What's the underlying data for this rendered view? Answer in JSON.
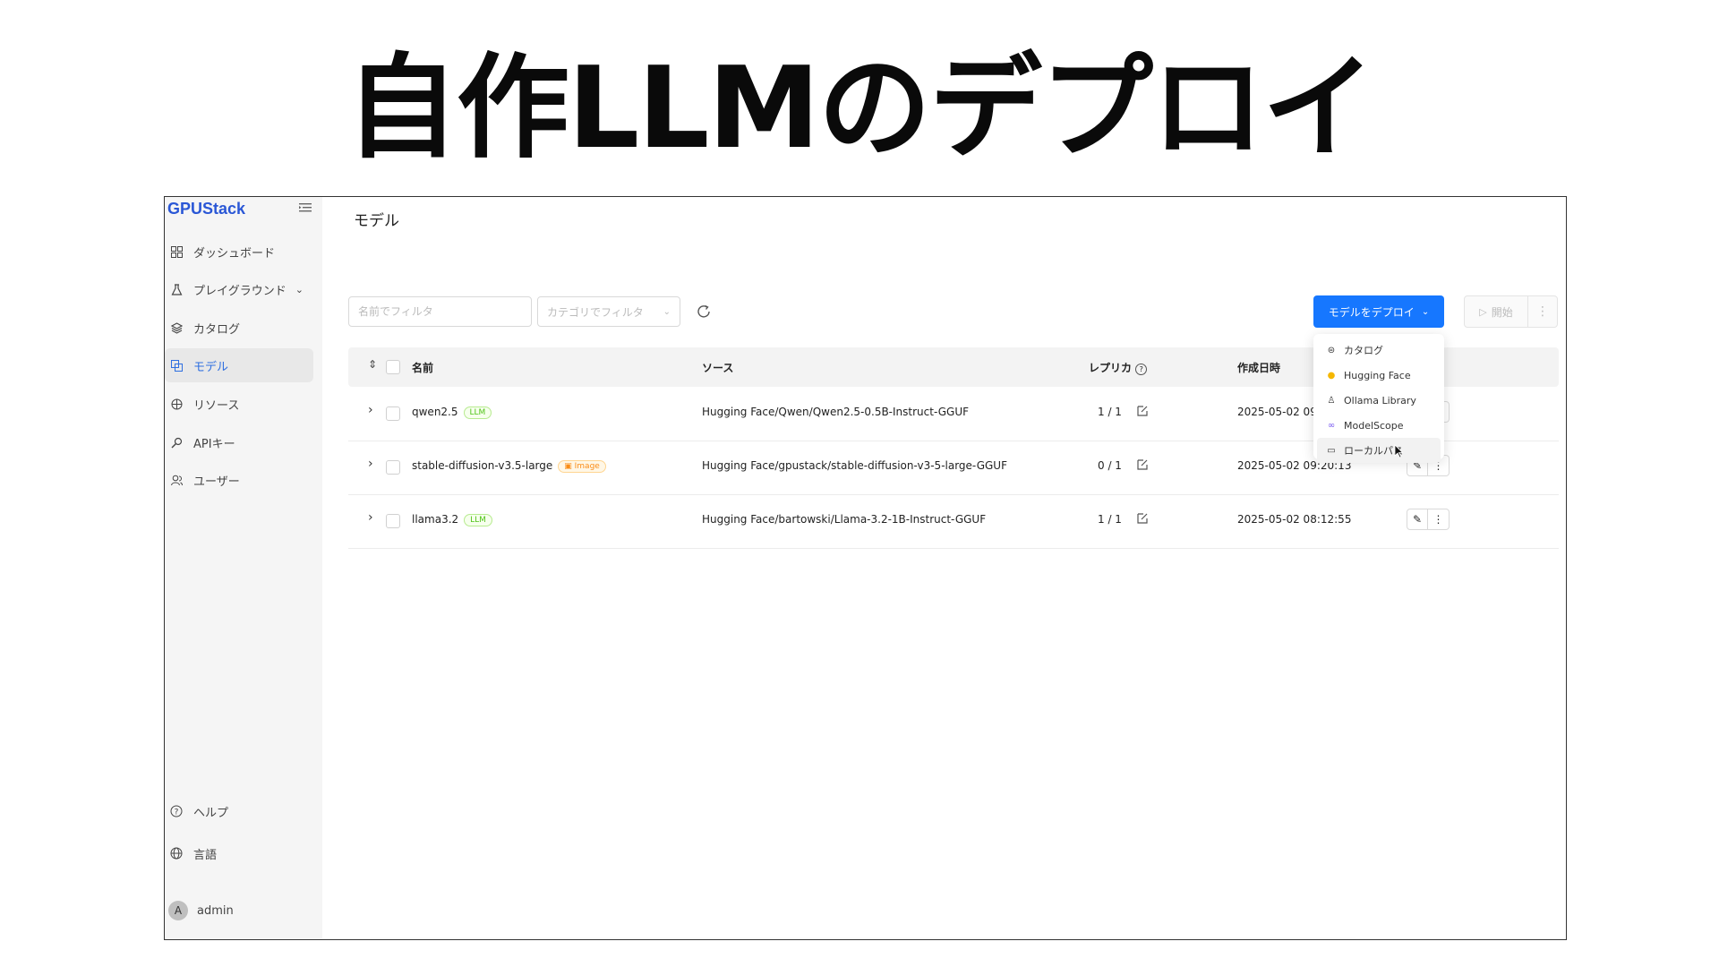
{
  "slide": {
    "title": "自作LLMのデプロイ"
  },
  "app": {
    "logo": "GPUStack",
    "page_title": "モデル"
  },
  "sidebar": {
    "items": [
      {
        "label": "ダッシュボード",
        "icon": "dashboard-icon"
      },
      {
        "label": "プレイグラウンド",
        "icon": "flask-icon"
      },
      {
        "label": "カタログ",
        "icon": "catalog-icon"
      },
      {
        "label": "モデル",
        "icon": "model-icon"
      },
      {
        "label": "リソース",
        "icon": "resource-icon"
      },
      {
        "label": "APIキー",
        "icon": "key-icon"
      },
      {
        "label": "ユーザー",
        "icon": "users-icon"
      }
    ],
    "footer": [
      {
        "label": "ヘルプ",
        "icon": "help-icon"
      },
      {
        "label": "言語",
        "icon": "globe-icon"
      }
    ],
    "user": {
      "avatar": "A",
      "name": "admin"
    }
  },
  "toolbar": {
    "name_filter_placeholder": "名前でフィルタ",
    "category_filter_placeholder": "カテゴリでフィルタ",
    "deploy_label": "モデルをデプロイ",
    "start_label": "開始"
  },
  "table": {
    "headers": {
      "name": "名前",
      "source": "ソース",
      "replicas": "レプリカ",
      "created": "作成日時"
    },
    "rows": [
      {
        "name": "qwen2.5",
        "tag": "LLM",
        "source": "Hugging Face/Qwen/Qwen2.5-0.5B-Instruct-GGUF",
        "replicas": "1 / 1",
        "created": "2025-05-02 09:4"
      },
      {
        "name": "stable-diffusion-v3.5-large",
        "tag": "Image",
        "source": "Hugging Face/gpustack/stable-diffusion-v3-5-large-GGUF",
        "replicas": "0 / 1",
        "created": "2025-05-02 09:20:13"
      },
      {
        "name": "llama3.2",
        "tag": "LLM",
        "source": "Hugging Face/bartowski/Llama-3.2-1B-Instruct-GGUF",
        "replicas": "1 / 1",
        "created": "2025-05-02 08:12:55"
      }
    ]
  },
  "deploy_menu": {
    "items": [
      {
        "label": "カタログ",
        "icon": "catalog-icon"
      },
      {
        "label": "Hugging Face",
        "icon": "huggingface-icon"
      },
      {
        "label": "Ollama Library",
        "icon": "ollama-icon"
      },
      {
        "label": "ModelScope",
        "icon": "modelscope-icon"
      },
      {
        "label": "ローカルパス",
        "icon": "local-path-icon"
      }
    ]
  },
  "colors": {
    "primary": "#1677ff",
    "active_nav": "#2f6fe0",
    "llm_tag": "#52c41a",
    "image_tag": "#fa8c16"
  }
}
